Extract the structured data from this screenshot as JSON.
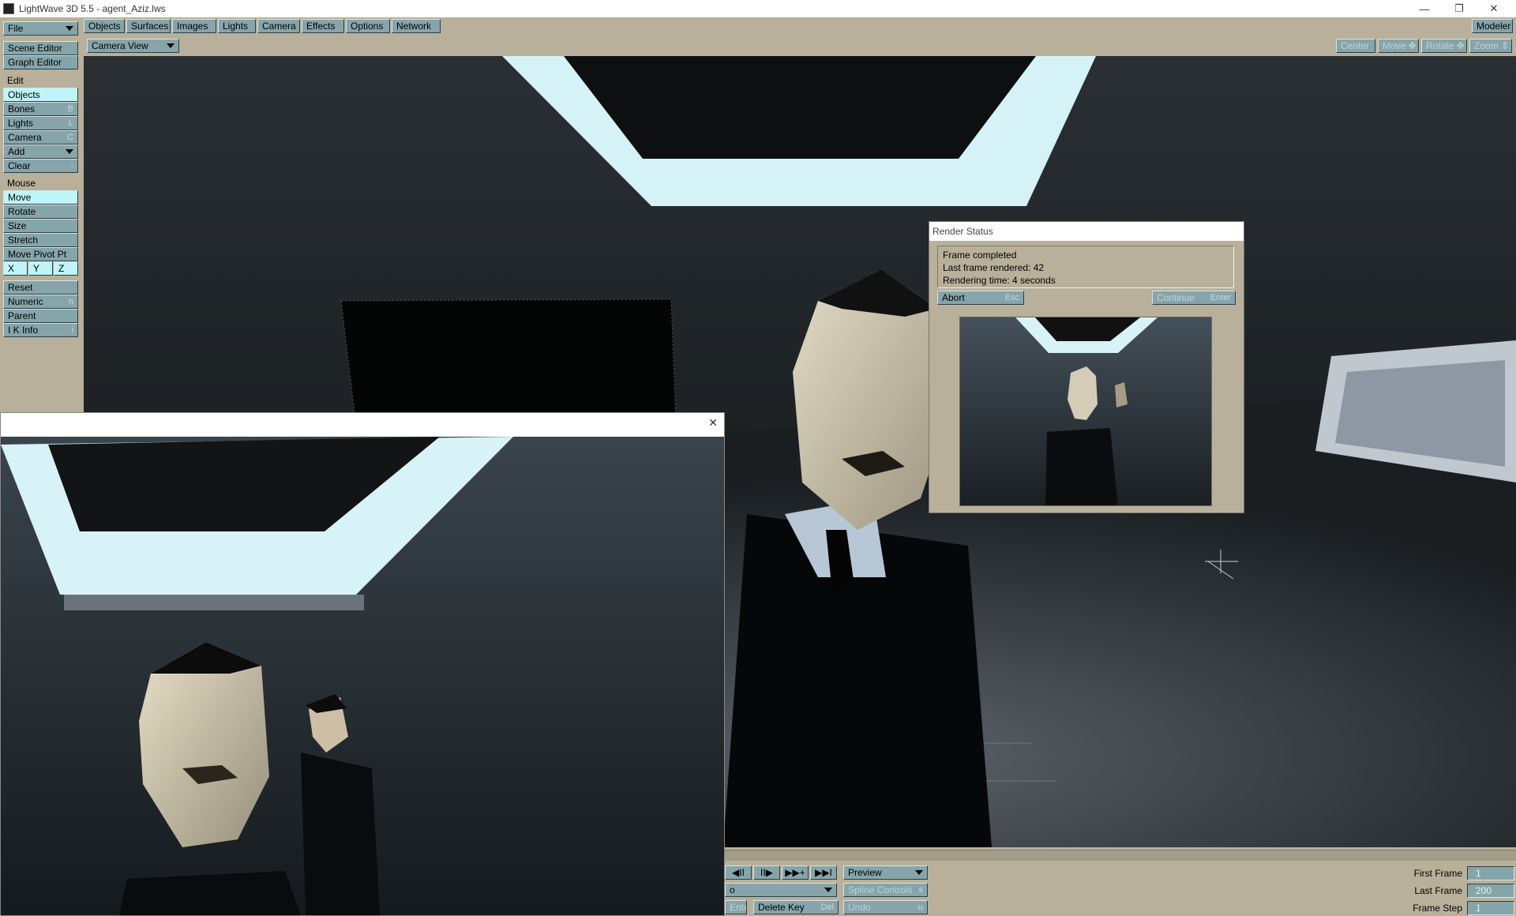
{
  "window": {
    "title": "LightWave 3D 5.5 - agent_Aziz.lws",
    "minimize": "—",
    "restore": "❐",
    "close": "✕"
  },
  "menu": {
    "file": "File",
    "tabs": [
      "Objects",
      "Surfaces",
      "Images",
      "Lights",
      "Camera",
      "Effects",
      "Options",
      "Network"
    ],
    "modeler": "Modeler"
  },
  "view": {
    "mode": "Camera View",
    "center": "Center",
    "move": "Move",
    "rotate": "Rotate",
    "zoom": "Zoom"
  },
  "sidebar": {
    "scene_editor": "Scene Editor",
    "graph_editor": "Graph Editor",
    "edit_label": "Edit",
    "edit_items": [
      {
        "label": "Objects",
        "key": ""
      },
      {
        "label": "Bones",
        "key": "B"
      },
      {
        "label": "Lights",
        "key": "L"
      },
      {
        "label": "Camera",
        "key": "C"
      },
      {
        "label": "Add",
        "key": ""
      },
      {
        "label": "Clear",
        "key": "-"
      }
    ],
    "mouse_label": "Mouse",
    "mouse_items": [
      {
        "label": "Move",
        "key": ""
      },
      {
        "label": "Rotate",
        "key": ""
      },
      {
        "label": "Size",
        "key": ""
      },
      {
        "label": "Stretch",
        "key": ""
      },
      {
        "label": "Move Pivot Pt",
        "key": ""
      }
    ],
    "axes": [
      "X",
      "Y",
      "Z"
    ],
    "misc_items": [
      {
        "label": "Reset",
        "key": ""
      },
      {
        "label": "Numeric",
        "key": "n"
      },
      {
        "label": "Parent",
        "key": ""
      },
      {
        "label": "I K Info",
        "key": "i"
      }
    ]
  },
  "render_status": {
    "title": "Render Status",
    "line1": "Frame completed",
    "line2": "Last frame rendered: 42",
    "line3": "Rendering time: 4 seconds",
    "abort": "Abort",
    "abort_key": "Esc",
    "continue": "Continue",
    "continue_key": "Enter"
  },
  "image_viewer": {
    "close": "✕"
  },
  "timeline": {
    "play_buttons": [
      "◀II",
      "II▶",
      "▶▶+",
      "▶▶I"
    ],
    "preview": "Preview",
    "spline_controls": "Spline Controls",
    "spline_key": "s",
    "undo": "Undo",
    "undo_key": "u",
    "key_value": "o",
    "enter_label": "Enter",
    "delete_key": "Delete Key",
    "delete_key_shortcut": "Del",
    "first_frame_label": "First Frame",
    "first_frame": "1",
    "last_frame_label": "Last Frame",
    "last_frame": "200",
    "frame_step_label": "Frame Step",
    "frame_step": "1"
  },
  "colors": {
    "panel": "#b8b09a",
    "button": "#85a5ab",
    "selected": "#bff5f8",
    "viewport": "#15191c"
  }
}
